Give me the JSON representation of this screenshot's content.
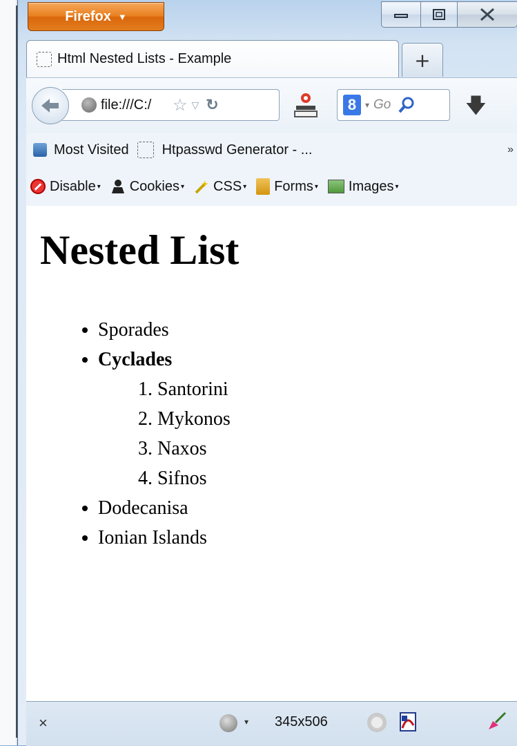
{
  "window": {
    "app_button_label": "Firefox",
    "app_button_arrow": "▼",
    "controls": {
      "minimize": "—",
      "maximize": "□",
      "close": "✕"
    }
  },
  "tabs": [
    {
      "label": "Html Nested Lists - Example",
      "icon": "dashed-page-icon"
    }
  ],
  "new_tab_label": "+",
  "navbar": {
    "url": "file:///C:/",
    "search_engine_letter": "8",
    "search_placeholder": "Go"
  },
  "bookmarks": {
    "items": [
      {
        "label": "Most Visited",
        "icon": "bookmarks-icon"
      },
      {
        "label": "Htpasswd Generator - ...",
        "icon": "dashed-page-icon"
      }
    ],
    "overflow": "»"
  },
  "devbar": {
    "items": [
      {
        "label": "Disable",
        "icon": "disable-icon"
      },
      {
        "label": "Cookies",
        "icon": "cookie-icon"
      },
      {
        "label": "CSS",
        "icon": "css-wand-icon"
      },
      {
        "label": "Forms",
        "icon": "forms-icon"
      },
      {
        "label": "Images",
        "icon": "images-icon"
      }
    ],
    "dropdown_marker": "▾"
  },
  "page": {
    "title": "Nested List",
    "islands": [
      {
        "label": "Sporades"
      },
      {
        "label": "Cyclades",
        "bold": true,
        "children": [
          "Santorini",
          "Mykonos",
          "Naxos",
          "Sifnos"
        ]
      },
      {
        "label": "Dodecanisa"
      },
      {
        "label": "Ionian Islands"
      }
    ]
  },
  "statusbar": {
    "close": "×",
    "dropdown": "▾",
    "viewport_size": "345x506"
  }
}
